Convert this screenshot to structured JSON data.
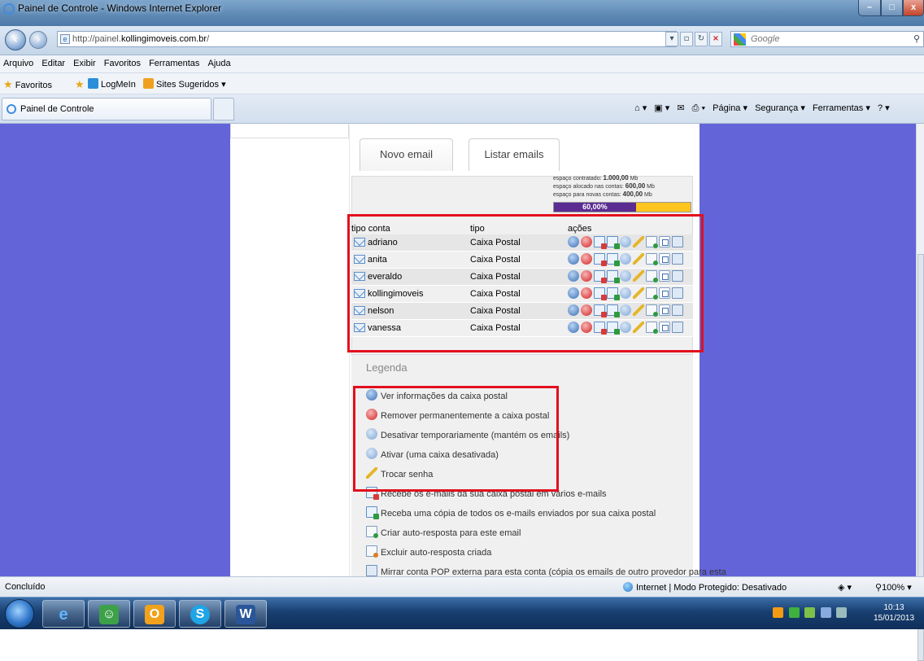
{
  "window": {
    "title": "Painel de Controle - Windows Internet Explorer",
    "min_glyph": "–",
    "max_glyph": "□",
    "close_glyph": "x"
  },
  "nav": {
    "url_prefix": "http://painel.",
    "url_host": "kollingimoveis.com.br",
    "url_suffix": "/",
    "search_placeholder": "Google"
  },
  "menu": [
    "Arquivo",
    "Editar",
    "Exibir",
    "Favoritos",
    "Ferramentas",
    "Ajuda"
  ],
  "favorites_bar": {
    "favorites_label": "Favoritos",
    "items": [
      "LogMeIn",
      "Sites Sugeridos ▾"
    ]
  },
  "tabs": {
    "active_label": "Painel de Controle"
  },
  "command_bar": {
    "pagina": "Página ▾",
    "seguranca": "Segurança ▾",
    "ferramentas": "Ferramentas ▾"
  },
  "panel": {
    "tab_new": "Novo email",
    "tab_list": "Listar emails",
    "quota": {
      "contracted_label": "espaço contratado:",
      "contracted_value": "1.000,00",
      "allocated_label": "espaço alocado nas contas:",
      "allocated_value": "600,00",
      "free_label": "espaço para novas contas:",
      "free_value": "400,00",
      "unit": "Mb",
      "percent_text": "60,00%",
      "percent_used": 60,
      "colors": {
        "used": "#5b2c92",
        "free": "#ffc51f"
      }
    },
    "table": {
      "headers": {
        "name": "tipo conta",
        "type": "tipo",
        "actions": "ações"
      },
      "rows": [
        {
          "name": "adriano",
          "type": "Caixa Postal"
        },
        {
          "name": "anita",
          "type": "Caixa Postal"
        },
        {
          "name": "everaldo",
          "type": "Caixa Postal"
        },
        {
          "name": "kollingimoveis",
          "type": "Caixa Postal"
        },
        {
          "name": "nelson",
          "type": "Caixa Postal"
        },
        {
          "name": "vanessa",
          "type": "Caixa Postal"
        }
      ]
    },
    "legend": {
      "title": "Legenda",
      "items": [
        {
          "icon": "info-icon",
          "text": "Ver informações da caixa postal"
        },
        {
          "icon": "delete-icon",
          "text": "Remover permanentemente a caixa postal"
        },
        {
          "icon": "pause-icon",
          "text": "Desativar temporariamente (mantém os emails)"
        },
        {
          "icon": "play-icon",
          "text": "Ativar (uma caixa desativada)"
        },
        {
          "icon": "key-icon",
          "text": "Trocar senha"
        },
        {
          "icon": "forward-mail-icon",
          "text": "Recebe os e-mails da sua caixa postal em vários e-mails"
        },
        {
          "icon": "copy-mail-icon",
          "text": "Receba uma cópia de todos os e-mails enviados por sua caixa postal"
        },
        {
          "icon": "autoreply-add-icon",
          "text": "Criar auto-resposta para este email"
        },
        {
          "icon": "autoreply-delete-icon",
          "text": "Excluir auto-resposta criada"
        },
        {
          "icon": "pop-mirror-icon",
          "text": "Mirrar conta POP externa para esta conta (cópia os emails de outro provedor para esta"
        }
      ]
    }
  },
  "status": {
    "left": "Concluído",
    "zone": "Internet | Modo Protegido: Desativado",
    "zoom": "100%"
  },
  "taskbar": {
    "apps": [
      "Internet Explorer",
      "Gerenciador",
      "Outlook",
      "Skype",
      "Word"
    ],
    "time": "10:13",
    "date": "15/01/2013"
  }
}
